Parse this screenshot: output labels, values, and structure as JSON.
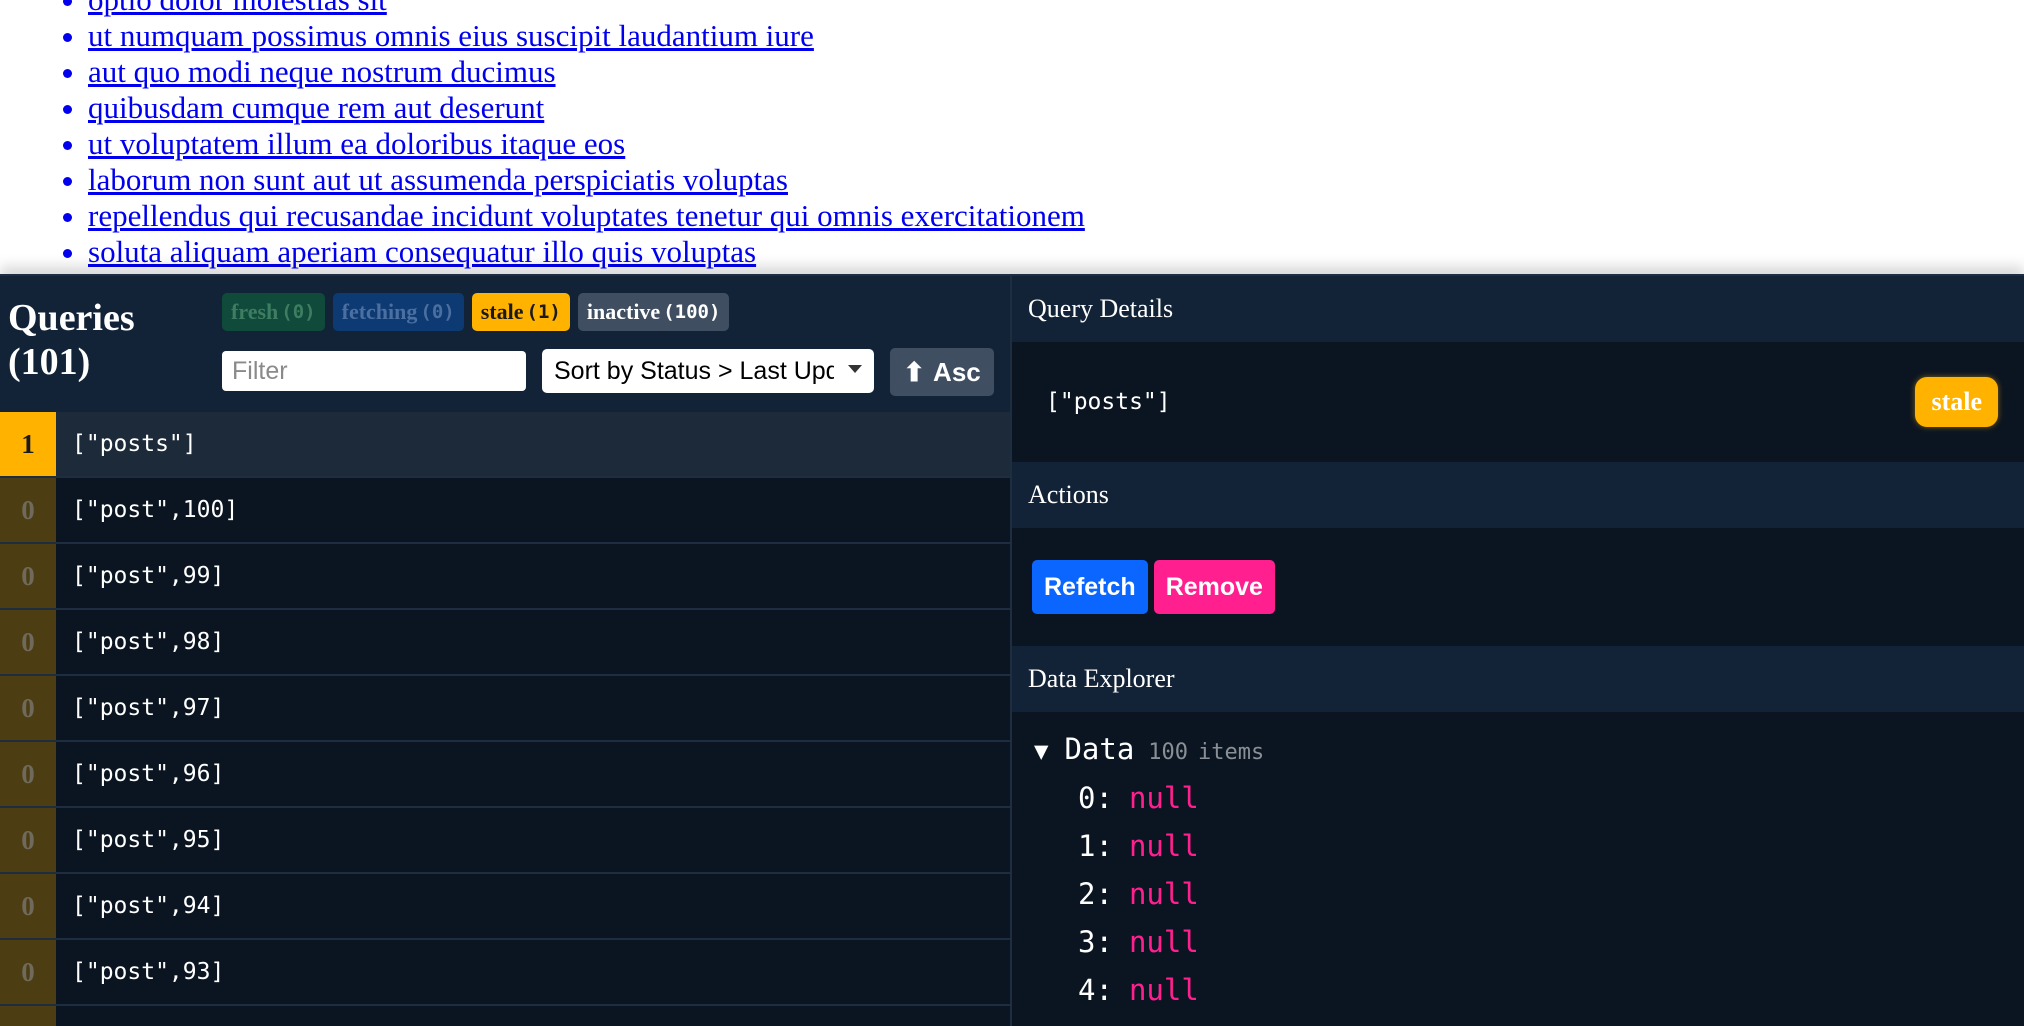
{
  "page": {
    "links": [
      "optio dolor molestias sit",
      "ut numquam possimus omnis eius suscipit laudantium iure",
      "aut quo modi neque nostrum ducimus",
      "quibusdam cumque rem aut deserunt",
      "ut voluptatem illum ea doloribus itaque eos",
      "laborum non sunt aut ut assumenda perspiciatis voluptas",
      "repellendus qui recusandae incidunt voluptates tenetur qui omnis exercitationem",
      "soluta aliquam aperiam consequatur illo quis voluptas"
    ]
  },
  "devtools": {
    "title": "Queries",
    "count": "101",
    "pills": {
      "fresh": {
        "label": "fresh",
        "count": "0"
      },
      "fetching": {
        "label": "fetching",
        "count": "0"
      },
      "stale": {
        "label": "stale",
        "count": "1"
      },
      "inactive": {
        "label": "inactive",
        "count": "100"
      }
    },
    "filter_placeholder": "Filter",
    "sort_value": "Sort by Status > Last Updated",
    "asc_label": "Asc",
    "queries": [
      {
        "observers": "1",
        "key": "[\"posts\"]"
      },
      {
        "observers": "0",
        "key": "[\"post\",100]"
      },
      {
        "observers": "0",
        "key": "[\"post\",99]"
      },
      {
        "observers": "0",
        "key": "[\"post\",98]"
      },
      {
        "observers": "0",
        "key": "[\"post\",97]"
      },
      {
        "observers": "0",
        "key": "[\"post\",96]"
      },
      {
        "observers": "0",
        "key": "[\"post\",95]"
      },
      {
        "observers": "0",
        "key": "[\"post\",94]"
      },
      {
        "observers": "0",
        "key": "[\"post\",93]"
      }
    ],
    "details": {
      "header": "Query Details",
      "key": "[\"posts\"]",
      "status": "stale"
    },
    "actions": {
      "header": "Actions",
      "refetch": "Refetch",
      "remove": "Remove"
    },
    "explorer": {
      "header": "Data Explorer",
      "label": "Data",
      "count": "100",
      "count_word": "items",
      "entries": [
        {
          "key": "0",
          "value": "null"
        },
        {
          "key": "1",
          "value": "null"
        },
        {
          "key": "2",
          "value": "null"
        },
        {
          "key": "3",
          "value": "null"
        },
        {
          "key": "4",
          "value": "null"
        }
      ]
    },
    "colors": {
      "panel_bg": "#0b1521",
      "header_bg": "#132337",
      "stale": "#ffb200",
      "refetch": "#0b66ff",
      "remove": "#ff1f8f"
    }
  }
}
